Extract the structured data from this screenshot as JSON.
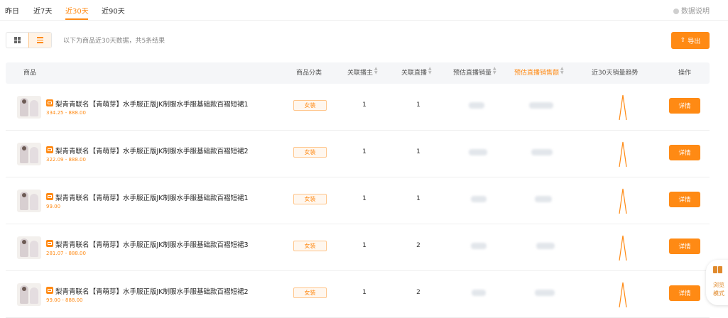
{
  "tabs": [
    {
      "label": "昨日",
      "active": false
    },
    {
      "label": "近7天",
      "active": false
    },
    {
      "label": "近30天",
      "active": true
    },
    {
      "label": "近90天",
      "active": false
    }
  ],
  "data_desc": "数据说明",
  "summary": "以下为商品近30天数据，共5条结果",
  "export_label": "导出",
  "accent_color": "#ff8a14",
  "columns": {
    "product": "商品",
    "category": "商品分类",
    "anchors": "关联播主",
    "lives": "关联直播",
    "est_sales": "预估直播销量",
    "est_revenue": "预估直播销售额",
    "trend": "近30天销量趋势",
    "action": "操作"
  },
  "rows": [
    {
      "title": "梨青青联名【青萌芽】水手服正版JK制服水手服基础款百褶短裙1",
      "price": "334.25 - 888.00",
      "category": "女装",
      "anchors": "1",
      "lives": "1",
      "detail": "详情"
    },
    {
      "title": "梨青青联名【青萌芽】水手服正版JK制服水手服基础款百褶短裙2",
      "price": "322.09 - 888.00",
      "category": "女装",
      "anchors": "1",
      "lives": "1",
      "detail": "详情"
    },
    {
      "title": "梨青青联名【青萌芽】水手服正版JK制服水手服基础款百褶短裙1",
      "price": "99.00",
      "category": "女装",
      "anchors": "1",
      "lives": "1",
      "detail": "详情"
    },
    {
      "title": "梨青青联名【青萌芽】水手服正版JK制服水手服基础款百褶短裙3",
      "price": "281.07 - 888.00",
      "category": "女装",
      "anchors": "1",
      "lives": "2",
      "detail": "详情"
    },
    {
      "title": "梨青青联名【青萌芽】水手服正版JK制服水手服基础款百褶短裙2",
      "price": "99.00 - 888.00",
      "category": "女装",
      "anchors": "1",
      "lives": "2",
      "detail": "详情"
    }
  ],
  "float_label": "浏览模式"
}
